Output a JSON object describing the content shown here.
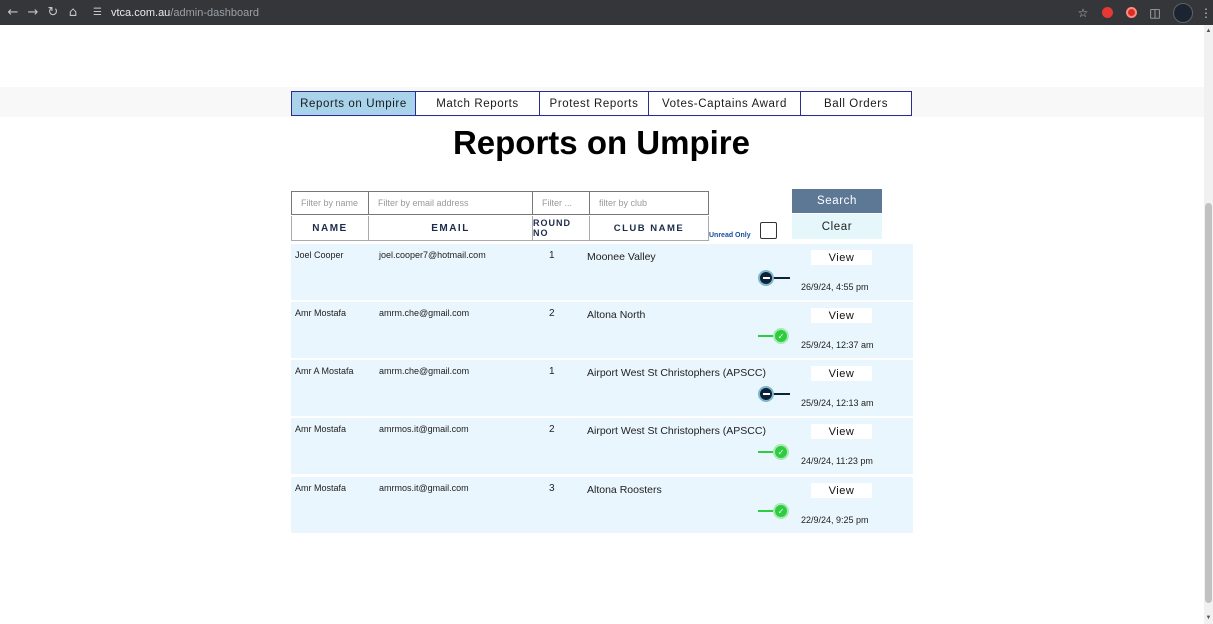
{
  "browser": {
    "url_host": "vtca.com.au",
    "url_path": "/admin-dashboard"
  },
  "tabs": [
    {
      "label": "Reports on Umpire",
      "active": true
    },
    {
      "label": "Match Reports",
      "active": false
    },
    {
      "label": "Protest Reports",
      "active": false
    },
    {
      "label": "Votes-Captains Award",
      "active": false
    },
    {
      "label": "Ball Orders",
      "active": false
    }
  ],
  "page_title": "Reports on Umpire",
  "filters": {
    "name_placeholder": "Filter by name",
    "email_placeholder": "Filter by email address",
    "round_placeholder": "Filter ...",
    "club_placeholder": "filter by club"
  },
  "columns": {
    "name": "NAME",
    "email": "EMAIL",
    "round": "ROUND NO",
    "club": "CLUB NAME"
  },
  "unread_only_label": "Unread Only",
  "buttons": {
    "search": "Search",
    "clear": "Clear",
    "view": "View"
  },
  "rows": [
    {
      "name": "Joel Cooper",
      "email": "joel.cooper7@hotmail.com",
      "round": "1",
      "club": "Moonee Valley",
      "read": false,
      "date": "26/9/24, 4:55 pm"
    },
    {
      "name": "Amr Mostafa",
      "email": "amrm.che@gmail.com",
      "round": "2",
      "club": "Altona North",
      "read": true,
      "date": "25/9/24, 12:37 am"
    },
    {
      "name": "Amr A Mostafa",
      "email": "amrm.che@gmail.com",
      "round": "1",
      "club": "Airport West St Christophers (APSCC)",
      "read": false,
      "date": "25/9/24, 12:13 am"
    },
    {
      "name": "Amr Mostafa",
      "email": "amrmos.it@gmail.com",
      "round": "2",
      "club": "Airport West St Christophers (APSCC)",
      "read": true,
      "date": "24/9/24, 11:23 pm"
    },
    {
      "name": "Amr Mostafa",
      "email": "amrmos.it@gmail.com",
      "round": "3",
      "club": "Altona Roosters",
      "read": true,
      "date": "22/9/24, 9:25 pm"
    }
  ]
}
